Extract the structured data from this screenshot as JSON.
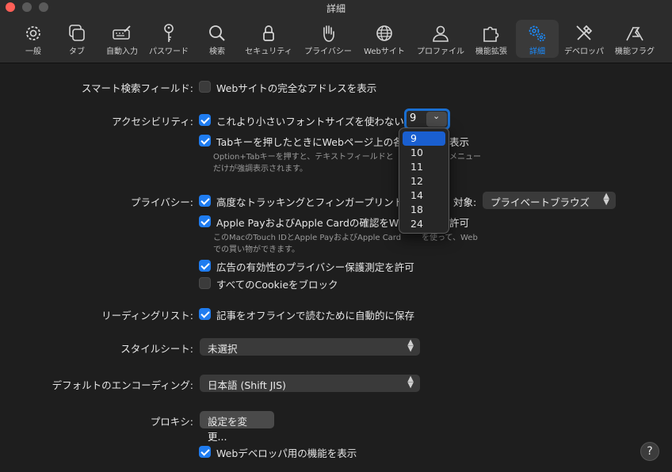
{
  "window": {
    "title": "詳細"
  },
  "toolbar": {
    "items": [
      {
        "label": "一般"
      },
      {
        "label": "タブ"
      },
      {
        "label": "自動入力"
      },
      {
        "label": "パスワード"
      },
      {
        "label": "検索"
      },
      {
        "label": "セキュリティ"
      },
      {
        "label": "プライバシー"
      },
      {
        "label": "Webサイト"
      },
      {
        "label": "プロファイル"
      },
      {
        "label": "機能拡張"
      },
      {
        "label": "詳細",
        "selected": true
      },
      {
        "label": "デベロッパ"
      },
      {
        "label": "機能フラグ"
      }
    ]
  },
  "smart_search": {
    "label": "スマート検索フィールド:",
    "option": "Webサイトの完全なアドレスを表示",
    "checked": false
  },
  "accessibility": {
    "label": "アクセシビリティ:",
    "min_font_option": "これより小さいフォントサイズを使わない:",
    "min_font_checked": true,
    "min_font_value": "9",
    "tab_option_left": "Tabキーを押したときにWebページ上の各",
    "tab_option_right": "表示",
    "tab_checked": true,
    "tab_help_line1_left": "Option+Tabキーを押すと、テキストフィールドと",
    "tab_help_line1_right": "メニュー",
    "tab_help_line2": "だけが強調表示されます。"
  },
  "font_size_menu": {
    "options": [
      "9",
      "10",
      "11",
      "12",
      "14",
      "18",
      "24"
    ],
    "selected": "9"
  },
  "privacy": {
    "label": "プライバシー:",
    "tracking_option": "高度なトラッキングとフィンガープリント",
    "tracking_checked": true,
    "target_label": "対象:",
    "target_value": "プライベートブラウズ",
    "applepay_option_left": "Apple PayおよびApple Cardの確認をW",
    "applepay_option_right": "許可",
    "applepay_checked": true,
    "applepay_help_line1_left": "このMacのTouch IDとApple PayおよびApple Card",
    "applepay_help_line1_right": "を使って、Web",
    "applepay_help_line2": "での買い物ができます。",
    "ads_option": "広告の有効性のプライバシー保護測定を許可",
    "ads_checked": true,
    "cookies_option": "すべてのCookieをブロック",
    "cookies_checked": false
  },
  "reading_list": {
    "label": "リーディングリスト:",
    "option": "記事をオフラインで読むために自動的に保存",
    "checked": true
  },
  "stylesheet": {
    "label": "スタイルシート:",
    "value": "未選択"
  },
  "encoding": {
    "label": "デフォルトのエンコーディング:",
    "value": "日本語 (Shift JIS)"
  },
  "proxy": {
    "label": "プロキシ:",
    "button": "設定を変更..."
  },
  "developer": {
    "option": "Webデベロッパ用の機能を表示",
    "checked": true
  },
  "help": {
    "label": "?"
  },
  "colors": {
    "accent": "#1f7cf0",
    "background": "#1e1e1e",
    "toolbar": "#2c2c2c"
  }
}
